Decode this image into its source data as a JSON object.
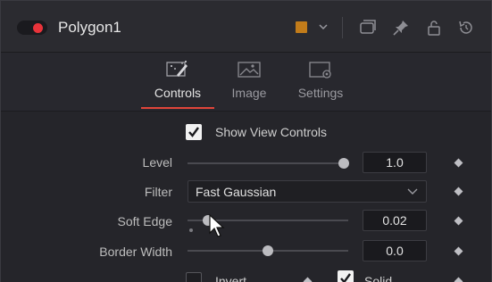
{
  "window": {
    "title": "Polygon1",
    "node_color": "#c27c1a",
    "enabled_color": "#e8333a"
  },
  "tabs": [
    {
      "label": "Controls",
      "icon": "controls-icon",
      "active": true
    },
    {
      "label": "Image",
      "icon": "image-icon",
      "active": false
    },
    {
      "label": "Settings",
      "icon": "settings-icon",
      "active": false
    }
  ],
  "controls": {
    "show_view_controls": {
      "label": "Show View Controls",
      "checked": true
    },
    "level": {
      "label": "Level",
      "value": "1.0",
      "slider_fraction": 1.0
    },
    "filter": {
      "label": "Filter",
      "value": "Fast Gaussian"
    },
    "soft_edge": {
      "label": "Soft Edge",
      "value": "0.02",
      "slider_fraction": 0.02
    },
    "border_width": {
      "label": "Border Width",
      "value": "0.0",
      "slider_fraction": 0.5
    },
    "invert": {
      "label": "Invert",
      "checked": false
    },
    "solid": {
      "label": "Solid",
      "checked": true
    }
  },
  "accent_color": "#e0453a"
}
